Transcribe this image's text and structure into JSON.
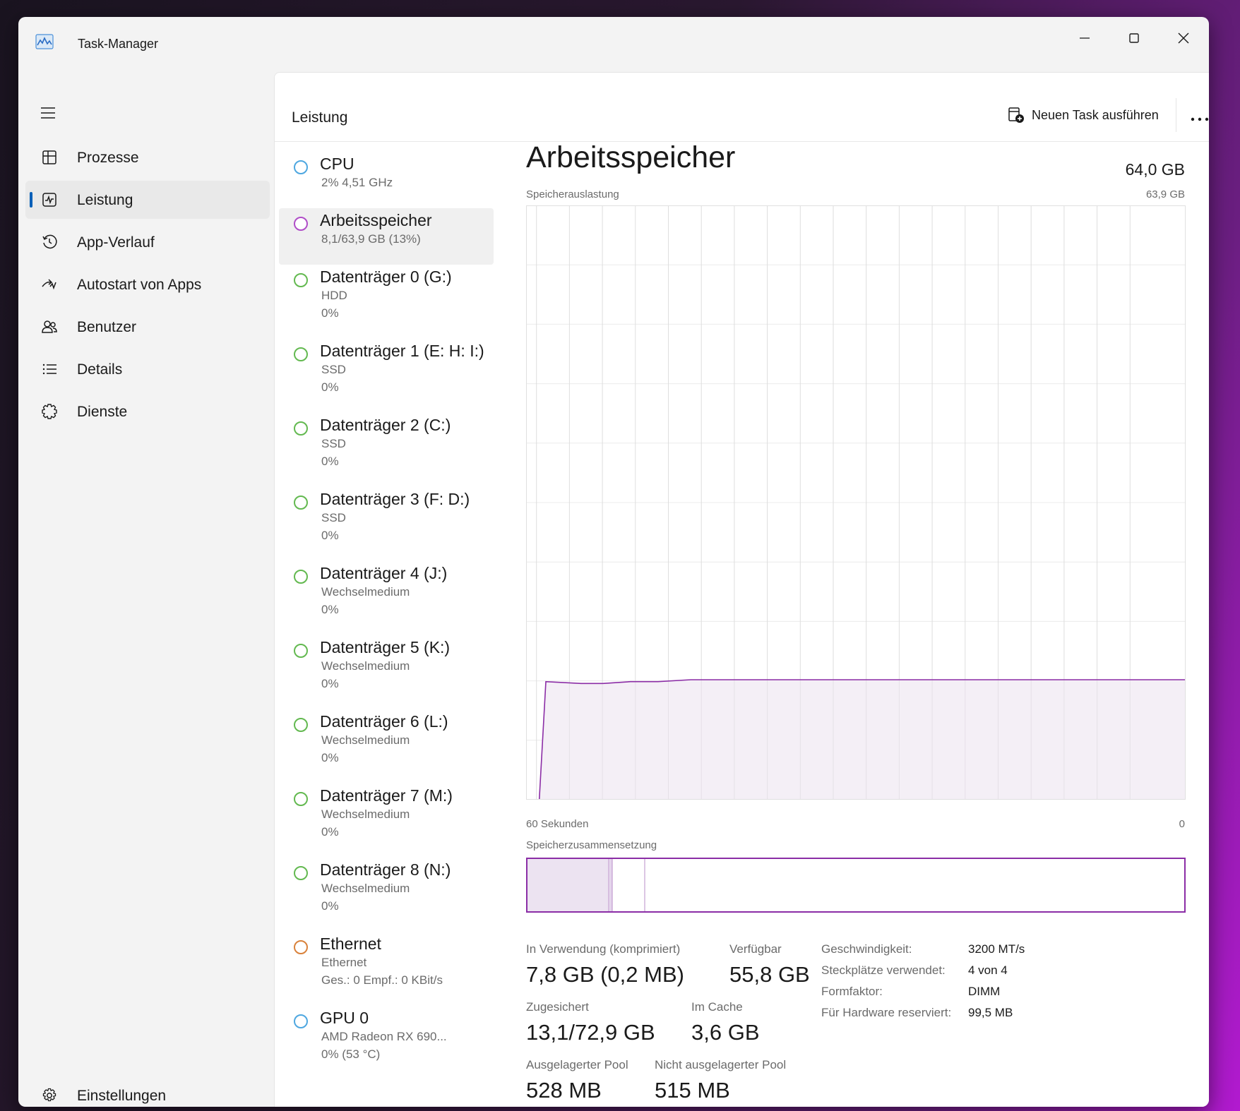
{
  "window": {
    "title": "Task-Manager"
  },
  "nav": {
    "items": [
      {
        "label": "Prozesse",
        "icon": "processes-icon"
      },
      {
        "label": "Leistung",
        "icon": "performance-icon",
        "active": true
      },
      {
        "label": "App-Verlauf",
        "icon": "history-icon"
      },
      {
        "label": "Autostart von Apps",
        "icon": "startup-icon"
      },
      {
        "label": "Benutzer",
        "icon": "users-icon"
      },
      {
        "label": "Details",
        "icon": "details-icon"
      },
      {
        "label": "Dienste",
        "icon": "services-icon"
      }
    ],
    "settings_label": "Einstellungen"
  },
  "header": {
    "title": "Leistung",
    "run_task_label": "Neuen Task ausführen"
  },
  "resources": [
    {
      "name": "CPU",
      "sub1": "2%  4,51 GHz",
      "sub2": "",
      "color": "#4ea7e0"
    },
    {
      "name": "Arbeitsspeicher",
      "sub1": "8,1/63,9 GB (13%)",
      "sub2": "",
      "color": "#b04dc8",
      "selected": true
    },
    {
      "name": "Datenträger 0 (G:)",
      "sub1": "HDD",
      "sub2": "0%",
      "color": "#63b950"
    },
    {
      "name": "Datenträger 1 (E: H: I:)",
      "sub1": "SSD",
      "sub2": "0%",
      "color": "#63b950"
    },
    {
      "name": "Datenträger 2 (C:)",
      "sub1": "SSD",
      "sub2": "0%",
      "color": "#63b950"
    },
    {
      "name": "Datenträger 3 (F: D:)",
      "sub1": "SSD",
      "sub2": "0%",
      "color": "#63b950"
    },
    {
      "name": "Datenträger 4 (J:)",
      "sub1": "Wechselmedium",
      "sub2": "0%",
      "color": "#63b950"
    },
    {
      "name": "Datenträger 5 (K:)",
      "sub1": "Wechselmedium",
      "sub2": "0%",
      "color": "#63b950"
    },
    {
      "name": "Datenträger 6 (L:)",
      "sub1": "Wechselmedium",
      "sub2": "0%",
      "color": "#63b950"
    },
    {
      "name": "Datenträger 7 (M:)",
      "sub1": "Wechselmedium",
      "sub2": "0%",
      "color": "#63b950"
    },
    {
      "name": "Datenträger 8 (N:)",
      "sub1": "Wechselmedium",
      "sub2": "0%",
      "color": "#63b950"
    },
    {
      "name": "Ethernet",
      "sub1": "Ethernet",
      "sub2": "Ges.: 0  Empf.: 0 KBit/s",
      "color": "#d9823b"
    },
    {
      "name": "GPU 0",
      "sub1": "AMD Radeon RX 690...",
      "sub2": "0%  (53 °C)",
      "color": "#4ea7e0"
    }
  ],
  "detail": {
    "title": "Arbeitsspeicher",
    "total": "64,0 GB",
    "usage_label": "Speicherauslastung",
    "usage_max": "63,9 GB",
    "time_left": "60 Sekunden",
    "time_right": "0",
    "composition_label": "Speicherzusammensetzung",
    "accent_color": "#8b2da6",
    "stats": {
      "in_use_label": "In Verwendung (komprimiert)",
      "in_use_value": "7,8 GB (0,2 MB)",
      "available_label": "Verfügbar",
      "available_value": "55,8 GB",
      "committed_label": "Zugesichert",
      "committed_value": "13,1/72,9 GB",
      "cached_label": "Im Cache",
      "cached_value": "3,6 GB",
      "paged_label": "Ausgelagerter Pool",
      "paged_value": "528 MB",
      "nonpaged_label": "Nicht ausgelagerter Pool",
      "nonpaged_value": "515 MB"
    },
    "props": {
      "speed_label": "Geschwindigkeit:",
      "speed_value": "3200 MT/s",
      "slots_label": "Steckplätze verwendet:",
      "slots_value": "4 von 4",
      "form_label": "Formfaktor:",
      "form_value": "DIMM",
      "reserved_label": "Für Hardware reserviert:",
      "reserved_value": "99,5 MB"
    }
  },
  "chart_data": {
    "type": "area",
    "title": "Speicherauslastung",
    "x": [
      60,
      58.8,
      58.2,
      55,
      53,
      50.5,
      48,
      45,
      0
    ],
    "xlabel": "",
    "ylabel": "",
    "x_range": [
      60,
      0
    ],
    "y": [
      0,
      0,
      12.7,
      12.5,
      12.5,
      12.7,
      12.7,
      12.9,
      12.9
    ],
    "ylim": [
      0,
      63.9
    ],
    "x_start_label": "60 Sekunden",
    "x_end_label": "0",
    "series_start_seconds": 60,
    "grid": true,
    "color": "#8b2da6"
  }
}
